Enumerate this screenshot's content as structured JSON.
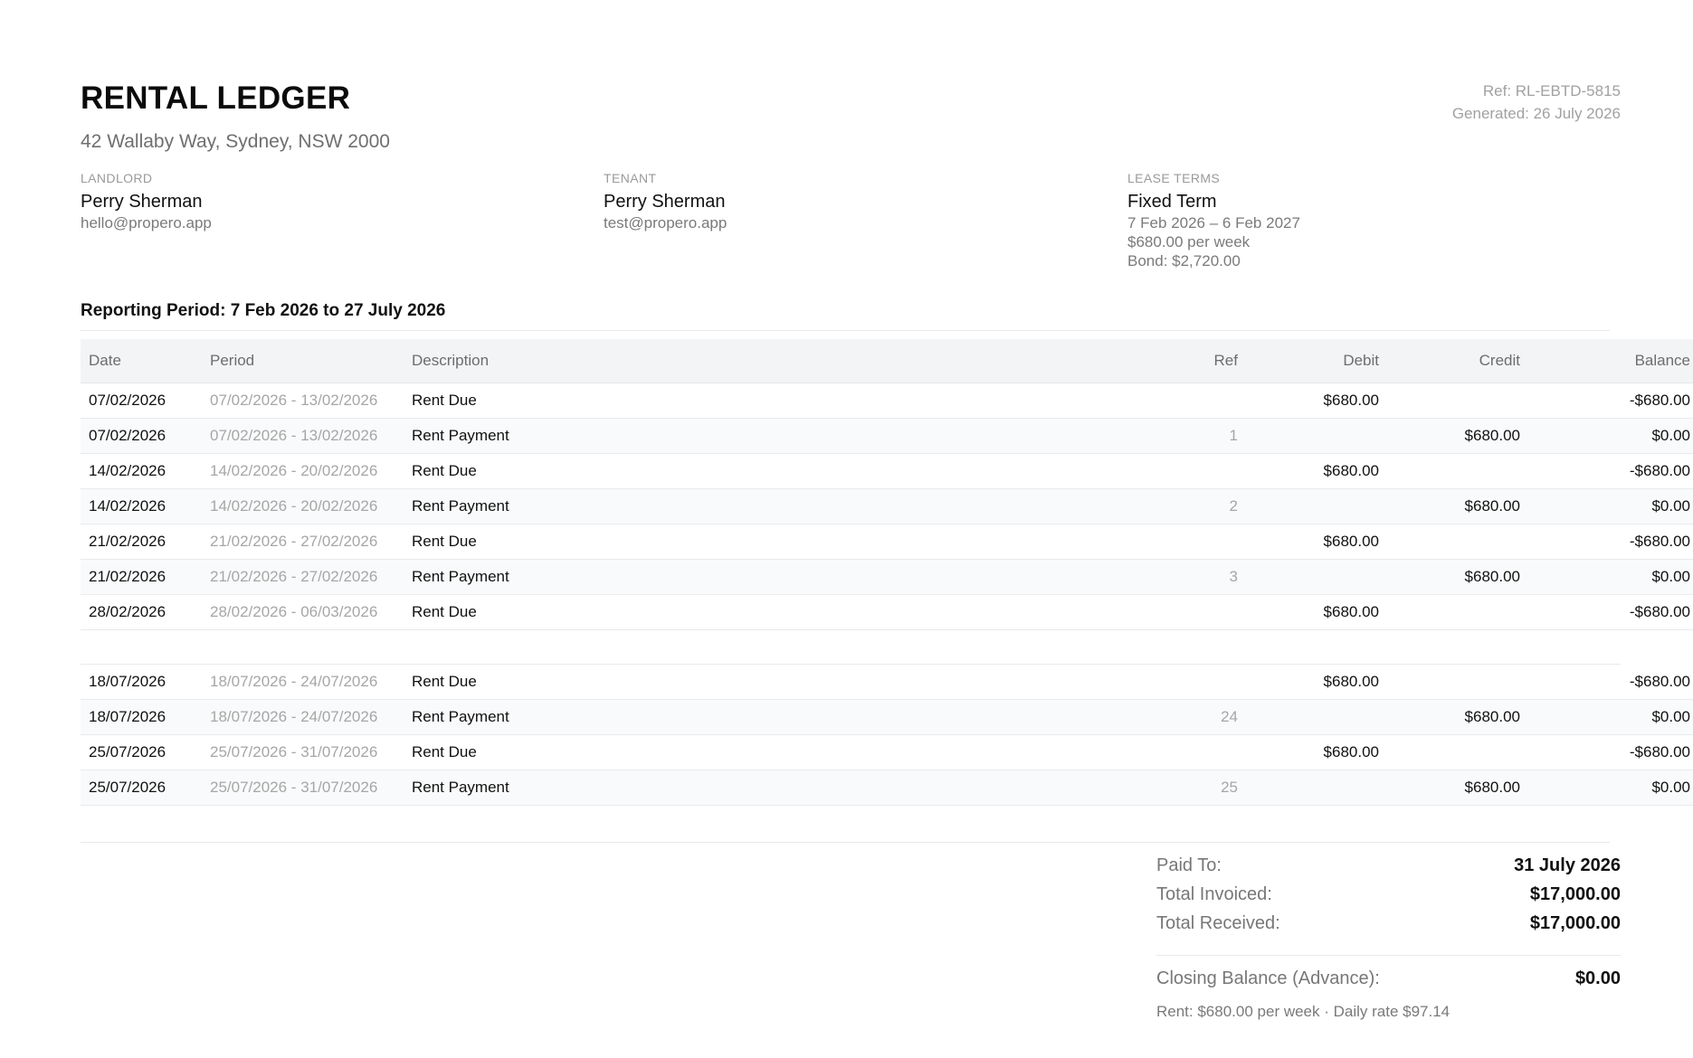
{
  "header": {
    "title": "RENTAL LEDGER",
    "address": "42 Wallaby Way, Sydney, NSW 2000",
    "ref": "Ref: RL-EBTD-5815",
    "generated": "Generated: 26 July 2026"
  },
  "landlord": {
    "label": "LANDLORD",
    "name": "Perry Sherman",
    "email": "hello@propero.app"
  },
  "tenant": {
    "label": "TENANT",
    "name": "Perry Sherman",
    "email": "test@propero.app"
  },
  "lease": {
    "label": "LEASE TERMS",
    "type": "Fixed Term",
    "dates": "7 Feb 2026 – 6 Feb 2027",
    "rent": "$680.00 per week",
    "bond": "Bond: $2,720.00"
  },
  "reporting_period": "Reporting Period: 7 Feb 2026 to 27 July 2026",
  "table": {
    "columns": {
      "date": "Date",
      "period": "Period",
      "description": "Description",
      "ref": "Ref",
      "debit": "Debit",
      "credit": "Credit",
      "balance": "Balance"
    },
    "rows_top": [
      {
        "date": "07/02/2026",
        "period": "07/02/2026 - 13/02/2026",
        "description": "Rent Due",
        "ref": "",
        "debit": "$680.00",
        "credit": "",
        "balance": "-$680.00"
      },
      {
        "date": "07/02/2026",
        "period": "07/02/2026 - 13/02/2026",
        "description": "Rent Payment",
        "ref": "1",
        "debit": "",
        "credit": "$680.00",
        "balance": "$0.00"
      },
      {
        "date": "14/02/2026",
        "period": "14/02/2026 - 20/02/2026",
        "description": "Rent Due",
        "ref": "",
        "debit": "$680.00",
        "credit": "",
        "balance": "-$680.00"
      },
      {
        "date": "14/02/2026",
        "period": "14/02/2026 - 20/02/2026",
        "description": "Rent Payment",
        "ref": "2",
        "debit": "",
        "credit": "$680.00",
        "balance": "$0.00"
      },
      {
        "date": "21/02/2026",
        "period": "21/02/2026 - 27/02/2026",
        "description": "Rent Due",
        "ref": "",
        "debit": "$680.00",
        "credit": "",
        "balance": "-$680.00"
      },
      {
        "date": "21/02/2026",
        "period": "21/02/2026 - 27/02/2026",
        "description": "Rent Payment",
        "ref": "3",
        "debit": "",
        "credit": "$680.00",
        "balance": "$0.00"
      },
      {
        "date": "28/02/2026",
        "period": "28/02/2026 - 06/03/2026",
        "description": "Rent Due",
        "ref": "",
        "debit": "$680.00",
        "credit": "",
        "balance": "-$680.00"
      }
    ],
    "rows_bottom": [
      {
        "date": "18/07/2026",
        "period": "18/07/2026 - 24/07/2026",
        "description": "Rent Due",
        "ref": "",
        "debit": "$680.00",
        "credit": "",
        "balance": "-$680.00"
      },
      {
        "date": "18/07/2026",
        "period": "18/07/2026 - 24/07/2026",
        "description": "Rent Payment",
        "ref": "24",
        "debit": "",
        "credit": "$680.00",
        "balance": "$0.00"
      },
      {
        "date": "25/07/2026",
        "period": "25/07/2026 - 31/07/2026",
        "description": "Rent Due",
        "ref": "",
        "debit": "$680.00",
        "credit": "",
        "balance": "-$680.00"
      },
      {
        "date": "25/07/2026",
        "period": "25/07/2026 - 31/07/2026",
        "description": "Rent Payment",
        "ref": "25",
        "debit": "",
        "credit": "$680.00",
        "balance": "$0.00"
      }
    ]
  },
  "summary": {
    "paid_to_label": "Paid To:",
    "paid_to_value": "31 July 2026",
    "total_invoiced_label": "Total Invoiced:",
    "total_invoiced_value": "$17,000.00",
    "total_received_label": "Total Received:",
    "total_received_value": "$17,000.00",
    "closing_label": "Closing Balance (Advance):",
    "closing_value": "$0.00",
    "note": "Rent: $680.00 per week · Daily rate $97.14"
  }
}
